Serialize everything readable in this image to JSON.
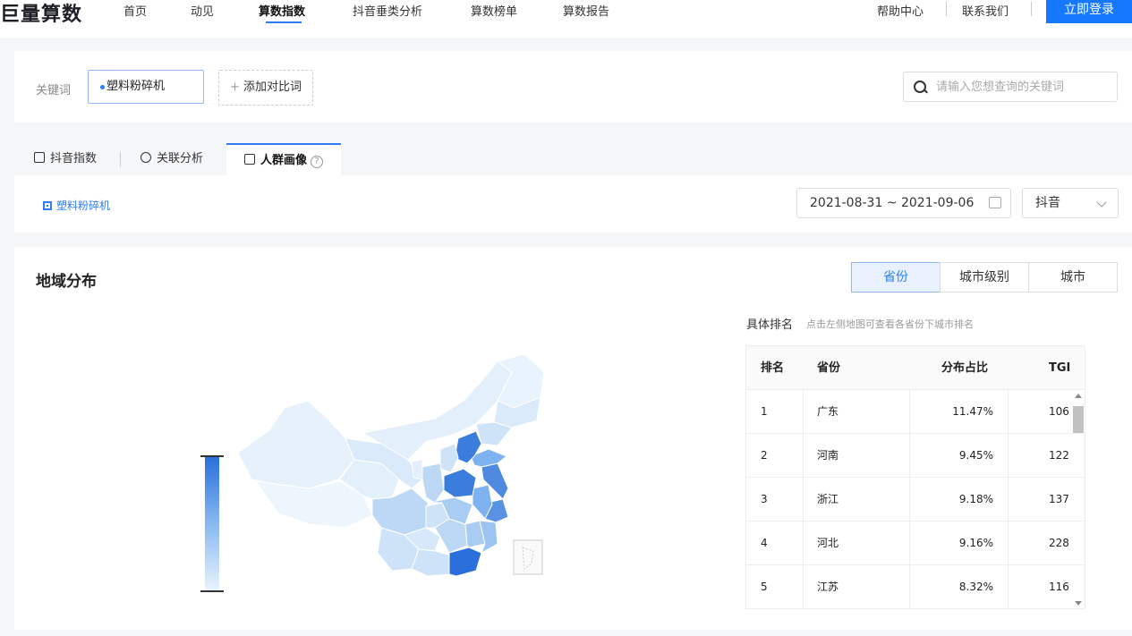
{
  "nav": {
    "brand": "巨量算数",
    "items": [
      "首页",
      "动见",
      "算数指数",
      "抖音垂类分析",
      "算数榜单",
      "算数报告"
    ],
    "active_index": 2,
    "right": [
      "帮助中心",
      "联系我们"
    ],
    "login": "立即登录"
  },
  "keyword": {
    "label": "关键词",
    "chip": "塑料粉碎机",
    "add": "添加对比词",
    "search_placeholder": "请输入您想查询的关键词"
  },
  "tabs": [
    "抖音指数",
    "关联分析",
    "人群画像"
  ],
  "active_tab": 2,
  "filter": {
    "legend": "塑料粉碎机",
    "date_range": "2021-08-31 ~ 2021-09-06",
    "platform": "抖音"
  },
  "region": {
    "title": "地域分布",
    "segments": [
      "省份",
      "城市级别",
      "城市"
    ],
    "active_segment": 0,
    "rank_title": "具体排名",
    "rank_hint": "点击左侧地图可查看各省份下城市排名",
    "columns": [
      "排名",
      "省份",
      "分布占比",
      "TGI"
    ],
    "rows": [
      {
        "rank": "1",
        "province": "广东",
        "share": "11.47%",
        "tgi": "106"
      },
      {
        "rank": "2",
        "province": "河南",
        "share": "9.45%",
        "tgi": "122"
      },
      {
        "rank": "3",
        "province": "浙江",
        "share": "9.18%",
        "tgi": "137"
      },
      {
        "rank": "4",
        "province": "河北",
        "share": "9.16%",
        "tgi": "228"
      },
      {
        "rank": "5",
        "province": "江苏",
        "share": "8.32%",
        "tgi": "116"
      }
    ]
  },
  "colors": {
    "accent": "#2d7df6",
    "login_bg": "#1677ff",
    "map_dark": "#2a6fdb",
    "map_light": "#eaf4fd"
  }
}
